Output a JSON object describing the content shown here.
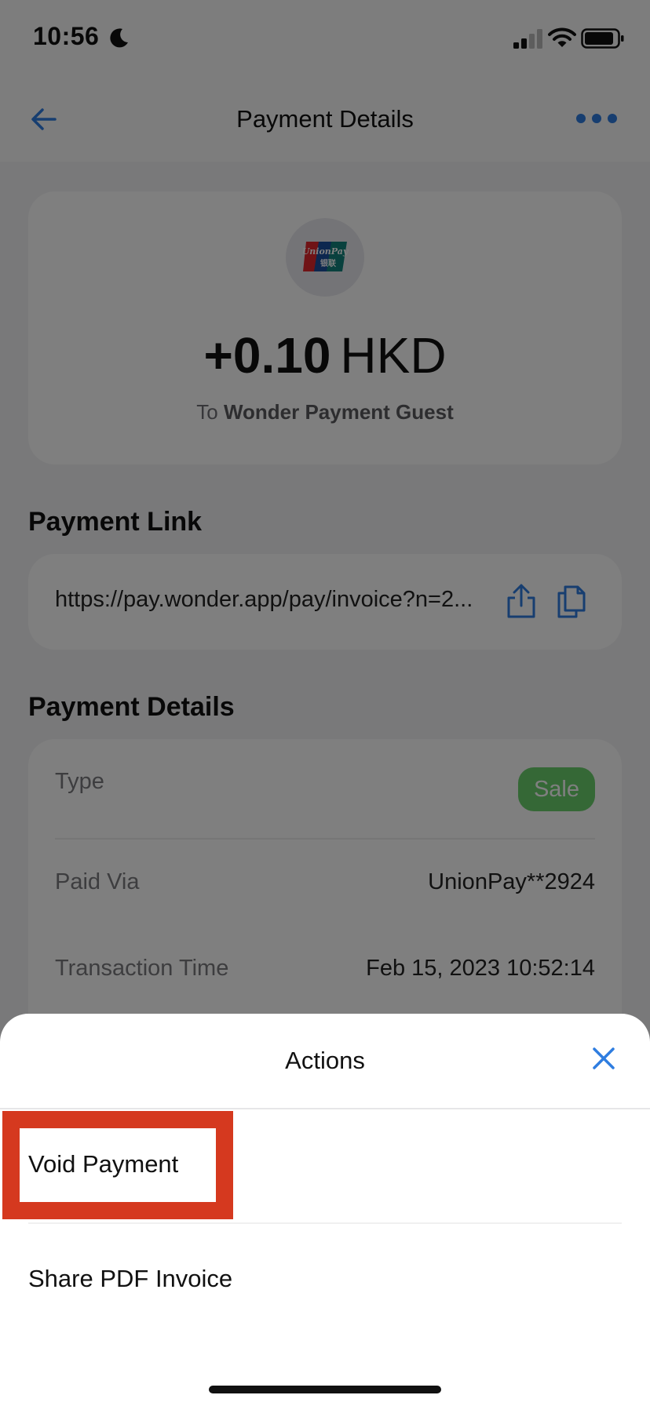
{
  "status_bar": {
    "time": "10:56"
  },
  "nav": {
    "title": "Payment Details"
  },
  "summary": {
    "amount": "+0.10",
    "currency": "HKD",
    "recipient_prefix": "To",
    "recipient_name": "Wonder Payment Guest",
    "card_brand_label": "UnionPay",
    "card_brand_sub": "银联"
  },
  "payment_link": {
    "header": "Payment Link",
    "url_display": "https://pay.wonder.app/pay/invoice?n=2..."
  },
  "details": {
    "header": "Payment Details",
    "rows": [
      {
        "label": "Type",
        "value": "Sale"
      },
      {
        "label": "Paid Via",
        "value": "UnionPay**2924"
      },
      {
        "label": "Transaction Time",
        "value": "Feb 15, 2023 10:52:14"
      }
    ]
  },
  "action_sheet": {
    "title": "Actions",
    "items": [
      {
        "label": "Void Payment"
      },
      {
        "label": "Share PDF Invoice"
      }
    ]
  },
  "colors": {
    "accent": "#2f7de0",
    "badge_green": "#6ad06d",
    "highlight_red": "#d5391f"
  },
  "icons": [
    "moon-icon",
    "signal-icon",
    "wifi-icon",
    "battery-icon",
    "back-arrow-icon",
    "more-icon",
    "unionpay-logo",
    "share-icon",
    "copy-icon",
    "close-icon"
  ]
}
